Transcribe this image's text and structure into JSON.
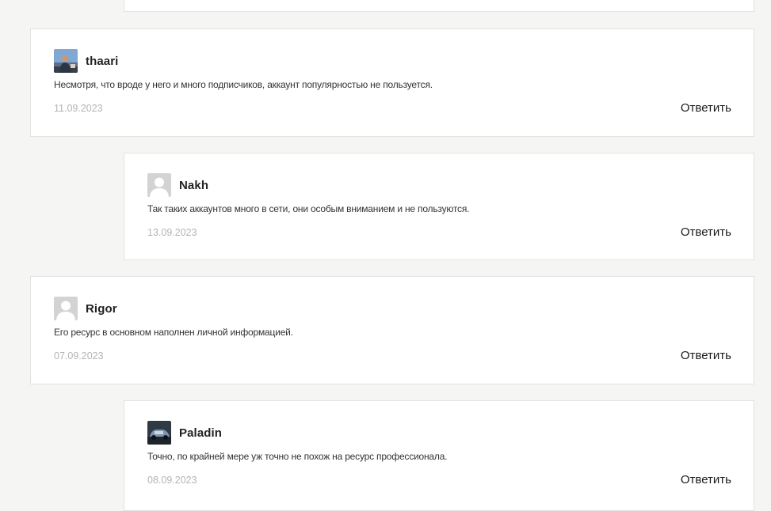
{
  "comments": [
    {
      "author": "thaari",
      "avatar": "photo-avatar-icon",
      "text": "Несмотря, что вроде у него и много подписчиков, аккаунт популярностью не пользуется.",
      "date": "11.09.2023",
      "reply_label": "Ответить"
    },
    {
      "author": "Nakh",
      "avatar": "default-user-avatar-icon",
      "text": "Так таких аккаунтов много в сети, они особым вниманием и не пользуются.",
      "date": "13.09.2023",
      "reply_label": "Ответить"
    },
    {
      "author": "Rigor",
      "avatar": "default-user-avatar-icon",
      "text": "Его ресурс в основном наполнен личной информацией.",
      "date": "07.09.2023",
      "reply_label": "Ответить"
    },
    {
      "author": "Paladin",
      "avatar": "car-photo-avatar-icon",
      "text": "Точно, по крайней мере уж точно не похож на ресурс профессионала.",
      "date": "08.09.2023",
      "reply_label": "Ответить"
    }
  ],
  "colors": {
    "page_background": "#f5f5f3",
    "card_background": "#ffffff",
    "card_border": "#e3e3e1",
    "date_text": "#b4b4b4"
  }
}
